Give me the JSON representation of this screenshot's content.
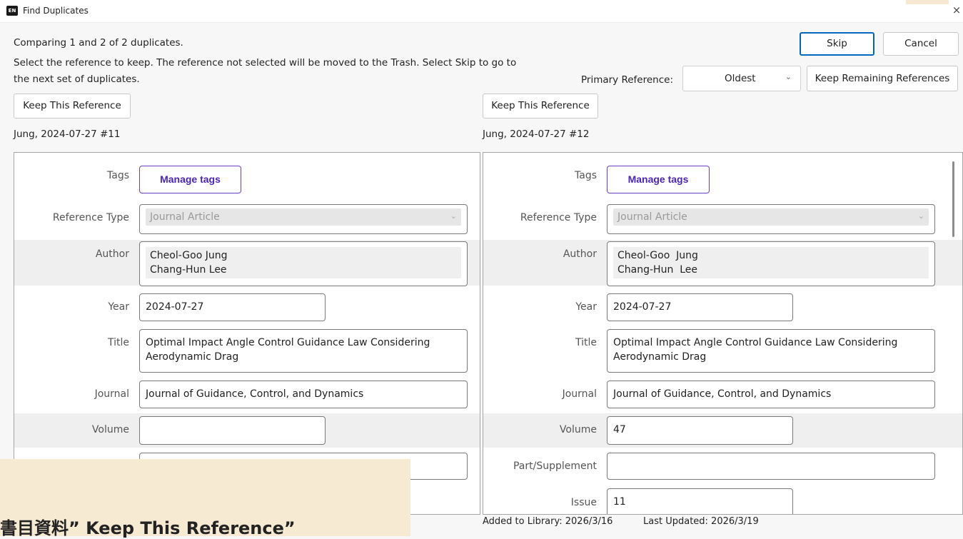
{
  "window": {
    "app_badge": "EN",
    "title": "Find Duplicates",
    "close_glyph": "×"
  },
  "header": {
    "comparing": "Comparing 1 and 2 of 2 duplicates.",
    "instructions_line1": "Select the reference to keep. The reference not selected will be moved to the Trash. Select Skip to go to",
    "instructions_line2": "the next set of duplicates.",
    "skip_label": "Skip",
    "cancel_label": "Cancel",
    "primary_reference_label": "Primary Reference:",
    "primary_reference_value": "Oldest",
    "keep_remaining_label": "Keep Remaining References"
  },
  "left": {
    "keep_label": "Keep This Reference",
    "ref_id": "Jung, 2024-07-27 #11",
    "tags_label": "Tags",
    "manage_tags": "Manage tags",
    "reference_type_label": "Reference Type",
    "reference_type": "Journal Article",
    "author_label": "Author",
    "authors": [
      "Cheol-Goo Jung",
      "Chang-Hun Lee"
    ],
    "year_label": "Year",
    "year": "2024-07-27",
    "title_label": "Title",
    "title_line1": "Optimal Impact Angle Control Guidance Law Considering",
    "title_line2": "Aerodynamic Drag",
    "journal_label": "Journal",
    "journal": "Journal of Guidance, Control, and Dynamics",
    "volume_label": "Volume",
    "volume": ""
  },
  "right": {
    "keep_label": "Keep This Reference",
    "ref_id": "Jung, 2024-07-27 #12",
    "tags_label": "Tags",
    "manage_tags": "Manage tags",
    "reference_type_label": "Reference Type",
    "reference_type": "Journal Article",
    "author_label": "Author",
    "authors": [
      "Cheol-Goo  Jung",
      "Chang-Hun  Lee"
    ],
    "year_label": "Year",
    "year": "2024-07-27",
    "title_label": "Title",
    "title_line1": "Optimal Impact Angle Control Guidance Law Considering",
    "title_line2": "Aerodynamic Drag",
    "journal_label": "Journal",
    "journal": "Journal of Guidance, Control, and Dynamics",
    "volume_label": "Volume",
    "volume": "47",
    "part_label": "Part/Supplement",
    "part": "",
    "issue_label": "Issue",
    "issue": "11",
    "added": "Added to Library: 2026/3/16",
    "updated": "Last Updated: 2026/3/19"
  },
  "caption_overlay": "書目資料” Keep This Reference”",
  "colors": {
    "accent": "#0067c0",
    "tag_purple": "#4b25b4",
    "overlay_bg": "#f6ead3"
  },
  "icons": {
    "chevron": "chevron-down-icon",
    "close": "close-icon"
  }
}
